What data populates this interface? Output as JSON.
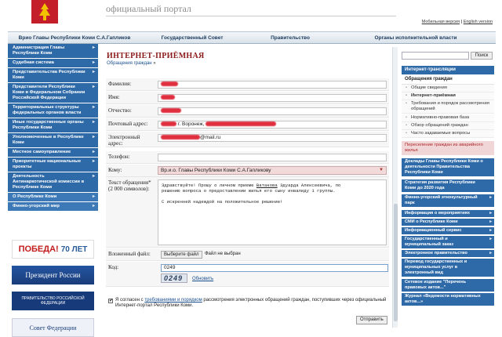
{
  "header": {
    "portal": "официальный портал",
    "mobile_link": "Мобильная версия",
    "sep": "|",
    "english_link": "English version"
  },
  "nav": {
    "items": [
      "Врио Главы Республики Коми С.А.Гапликов",
      "Государственный Совет",
      "Правительство",
      "Органы исполнительной власти"
    ]
  },
  "left_menu": [
    "Администрация Главы Республики Коми",
    "Судебная система",
    "Представительства Республики Коми",
    "Представители Республики Коми в Федеральном Собрании Российской Федерации",
    "Территориальные структуры федеральных органов власти",
    "Иные государственные органы Республики Коми",
    "Уполномоченные в Республике Коми",
    "Местное самоуправление",
    "Приоритетные национальные проекты",
    "Деятельность Антинаркотической комиссии в Республике Коми",
    "О Республике Коми",
    "Финно-угорский мир"
  ],
  "banners": {
    "pobeda": "ПОБЕДА!",
    "years": "70 ЛЕТ",
    "president": "Президент России",
    "government": "ПРАВИТЕЛЬСТВО РОССИЙСКОЙ ФЕДЕРАЦИИ",
    "sovet": "Совет Федерации"
  },
  "main": {
    "title": "ИНТЕРНЕТ-ПРИЁМНАЯ",
    "crumb": "Обращения граждан",
    "crumb_arrow": "»"
  },
  "form": {
    "lastname_label": "Фамилия:",
    "firstname_label": "Имя:",
    "patronymic_label": "Отчество:",
    "address_label": "Почтовый адрес:",
    "address_value": "г. Воронеж,",
    "email_label": "Электронный адрес:",
    "email_value": "@mail.ru",
    "phone_label": "Телефон:",
    "to_label": "Кому:",
    "to_value": "Вр.и.о. Главы Республики Коми С.А.Гапликову",
    "text_label": "Текст обращения* (2 000 символов):",
    "text_line1": "Здравствуйте! Прошу о личном приеме ",
    "text_name": "Ватакова",
    "text_line1b": " Эдуарда Алексеевича, по",
    "text_line2": "решению вопроса о предоставлении жилья его сыну инвалиду 1 группы.",
    "text_line3": "С искренней надеждой на положительное решение!",
    "file_label": "Вложенный файл:",
    "file_button": "Выберите файл",
    "file_none": "Файл не выбран",
    "code_label": "Код:",
    "code_value": "0249",
    "captcha_text": "0249",
    "refresh_link": "Обновить",
    "agree_prefix": "Я согласен с ",
    "agree_link": "требованиями и порядком",
    "agree_suffix": " рассмотрения электронных обращений граждан, поступивших через официальный Интернет-портал Республики Коми.",
    "checkbox_mark": "✔",
    "send_button": "Отправить"
  },
  "right": {
    "search_button": "Поиск",
    "internet_header": "Интернет-трансляции",
    "appeals_header": "Обращения граждан",
    "sub_items": [
      "Общие сведения",
      "Интернет-приёмная",
      "Требования и порядок рассмотрения обращений",
      "Нормативно-правовая база",
      "Обзор обращений граждан",
      "Часто задаваемые вопросы"
    ],
    "emergency": "Переселение граждан из аварийного жилья",
    "blue_items": [
      "Доклады Главы Республики Коми о деятельности Правительства Республики Коми",
      "Стратегия развития Республики Коми до 2020 года",
      "Финно-угорский этнокультурный парк",
      "Информация о мероприятиях",
      "СМИ о Республике Коми",
      "Информационный сервис",
      "Государственный и муниципальный заказ",
      "Электронное правительство",
      "Перевод государственных и муниципальных услуг в электронный вид",
      "Сетевое издание \"Перечень правовых актов...\"",
      "Журнал «Ведомости нормативных актов...»"
    ]
  }
}
